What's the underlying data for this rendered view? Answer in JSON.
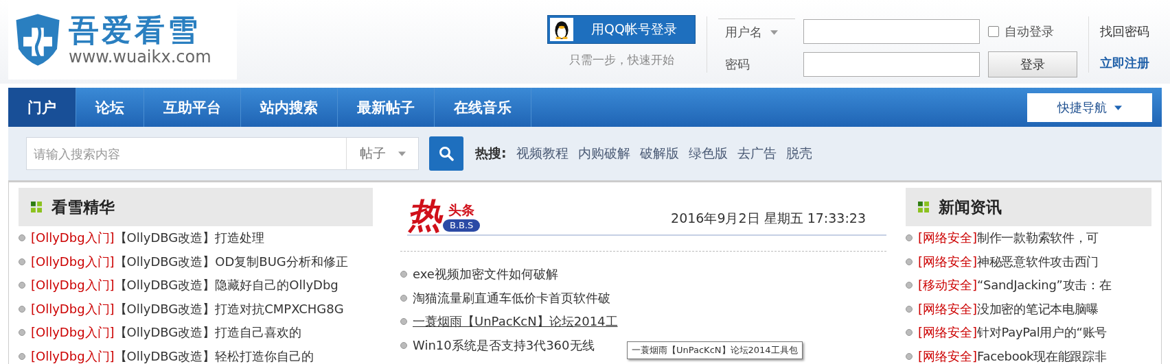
{
  "logo": {
    "title": "吾爱看雪",
    "url": "www.wuaikx.com"
  },
  "qq_login": {
    "label": "用QQ帐号登录",
    "hint": "只需一步，快速开始"
  },
  "login": {
    "username_label": "用户名",
    "password_label": "密码",
    "auto_login": {
      "label": "自动登录",
      "checked": false
    },
    "login_button": "登录",
    "links": [
      {
        "label": "找回密码",
        "kind": "plain"
      },
      {
        "label": "立即注册",
        "kind": "strong"
      }
    ]
  },
  "nav": {
    "items": [
      {
        "label": "门户",
        "selected": true
      },
      {
        "label": "论坛",
        "selected": false
      },
      {
        "label": "互助平台",
        "selected": false
      },
      {
        "label": "站内搜索",
        "selected": false
      },
      {
        "label": "最新帖子",
        "selected": false
      },
      {
        "label": "在线音乐",
        "selected": false
      }
    ],
    "quick_nav": "快捷导航"
  },
  "search": {
    "placeholder": "请输入搜索内容",
    "scope": "帖子",
    "hot_label": "热搜:",
    "hot_terms": [
      "视频教程",
      "内购破解",
      "破解版",
      "绿色版",
      "去广告",
      "脱壳"
    ]
  },
  "featured": {
    "title": "看雪精华",
    "items": [
      {
        "tag": "[OllyDbg入门]",
        "text": "【OllyDBG改造】打造处理"
      },
      {
        "tag": "[OllyDbg入门]",
        "text": "【OllyDBG改造】OD复制BUG分析和修正"
      },
      {
        "tag": "[OllyDbg入门]",
        "text": "【OllyDBG改造】隐藏好自己的OllyDbg"
      },
      {
        "tag": "[OllyDbg入门]",
        "text": "【OllyDBG改造】打造对抗CMPXCHG8G"
      },
      {
        "tag": "[OllyDbg入门]",
        "text": "【OllyDBG改造】打造自己喜欢的"
      },
      {
        "tag": "[OllyDbg入门]",
        "text": "【OllyDBG改造】轻松打造你自己的"
      }
    ]
  },
  "headlines": {
    "hot": "热",
    "label": "头条",
    "badge": "B.B.S",
    "date": "2016年9月2日 星期五 17:33:23",
    "items": [
      {
        "text": "exe视频加密文件如何破解",
        "hovered": false
      },
      {
        "text": "淘猫流量刷直通车低价卡首页软件破",
        "hovered": false
      },
      {
        "text": "一蓑烟雨【UnPacKcN】论坛2014工",
        "hovered": true
      },
      {
        "text": "Win10系统是否支持3代360无线",
        "hovered": false
      }
    ],
    "tooltip": "一蓑烟雨【UnPacKcN】论坛2014工具包"
  },
  "news": {
    "title": "新闻资讯",
    "items": [
      {
        "tag": "[网络安全]",
        "text": "制作一款勒索软件，可"
      },
      {
        "tag": "[网络安全]",
        "text": "神秘恶意软件攻击西门"
      },
      {
        "tag": "[移动安全]",
        "text": "“SandJacking”攻击：在"
      },
      {
        "tag": "[网络安全]",
        "text": "没加密的笔记本电脑曝"
      },
      {
        "tag": "[网络安全]",
        "text": "针对PayPal用户的“账号"
      },
      {
        "tag": "[网络安全]",
        "text": "Facebook现在能跟踪非"
      }
    ]
  }
}
